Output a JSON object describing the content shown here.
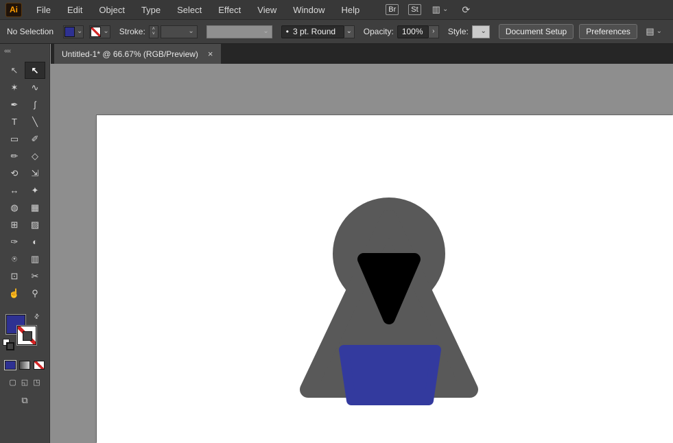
{
  "app": {
    "logo_text": "Ai"
  },
  "menubar": {
    "menus": [
      "File",
      "Edit",
      "Object",
      "Type",
      "Select",
      "Effect",
      "View",
      "Window",
      "Help"
    ],
    "bridge_label": "Br",
    "stock_label": "St"
  },
  "controlbar": {
    "selection_status": "No Selection",
    "stroke_label": "Stroke:",
    "brush_name": "3 pt. Round",
    "opacity_label": "Opacity:",
    "opacity_value": "100%",
    "style_label": "Style:",
    "document_setup_label": "Document Setup",
    "preferences_label": "Preferences"
  },
  "tabbar": {
    "tab_title": "Untitled-1* @ 66.67% (RGB/Preview)"
  },
  "toolbar": {
    "tools": [
      {
        "name": "direct-selection",
        "glyph": "↖"
      },
      {
        "name": "selection",
        "glyph": "↖"
      },
      {
        "name": "magic-wand",
        "glyph": "✶"
      },
      {
        "name": "lasso",
        "glyph": "∿"
      },
      {
        "name": "pen",
        "glyph": "✒"
      },
      {
        "name": "curvature",
        "glyph": "ʃ"
      },
      {
        "name": "type",
        "glyph": "T"
      },
      {
        "name": "line-segment",
        "glyph": "╲"
      },
      {
        "name": "rectangle",
        "glyph": "▭"
      },
      {
        "name": "paintbrush",
        "glyph": "✐"
      },
      {
        "name": "pencil",
        "glyph": "✏"
      },
      {
        "name": "eraser",
        "glyph": "◇"
      },
      {
        "name": "rotate",
        "glyph": "⟲"
      },
      {
        "name": "scale",
        "glyph": "⇲"
      },
      {
        "name": "width",
        "glyph": "↔"
      },
      {
        "name": "free-transform",
        "glyph": "✦"
      },
      {
        "name": "shape-builder",
        "glyph": "◍"
      },
      {
        "name": "perspective-grid",
        "glyph": "▦"
      },
      {
        "name": "mesh",
        "glyph": "⊞"
      },
      {
        "name": "gradient",
        "glyph": "▨"
      },
      {
        "name": "eyedropper",
        "glyph": "✑"
      },
      {
        "name": "blend",
        "glyph": "◐"
      },
      {
        "name": "symbol-sprayer",
        "glyph": "⍟"
      },
      {
        "name": "column-graph",
        "glyph": "▥"
      },
      {
        "name": "artboard",
        "glyph": "⊡"
      },
      {
        "name": "slice",
        "glyph": "✂"
      },
      {
        "name": "hand",
        "glyph": "☝"
      },
      {
        "name": "zoom",
        "glyph": "⚲"
      }
    ]
  },
  "icons": {
    "chevron_down": "⌄",
    "chevron_right": "›",
    "spinner_up": "˄",
    "spinner_down": "˅",
    "close": "×",
    "collapse": "««",
    "bullet": "•",
    "swap_arrows": "⇄",
    "workspace": "▥",
    "sync": "⟳",
    "arrange": "▤",
    "screen_mode": "⧉",
    "draw_normal": "▢",
    "draw_behind": "◱",
    "draw_inside": "◳"
  },
  "colors": {
    "fill_swatch": "#2e3192",
    "canvas_gray": "#8e8e8e",
    "figure_gray": "#595959",
    "figure_black": "#000000",
    "figure_blue": "#333a9e"
  }
}
